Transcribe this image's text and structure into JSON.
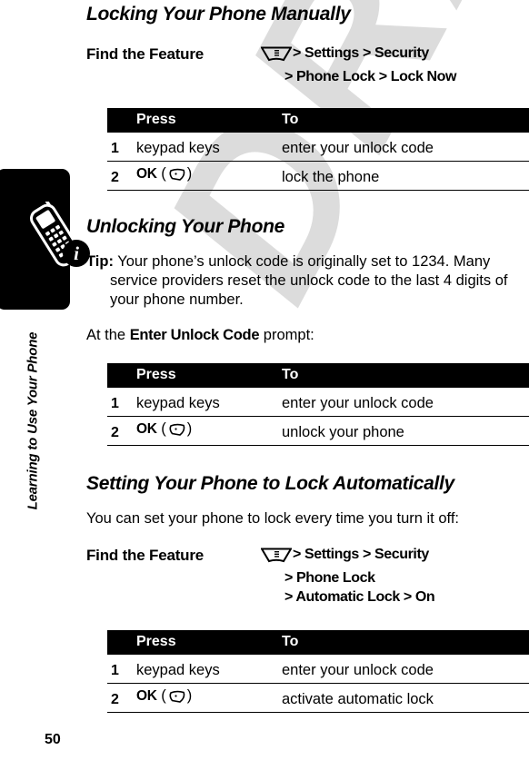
{
  "page": {
    "number": "50",
    "side_tab_title": "Learning to Use Your Phone",
    "watermark": "DRAFT",
    "info_badge_glyph": "i"
  },
  "sections": [
    {
      "heading": "Locking Your Phone Manually",
      "find_the_feature": {
        "label": "Find the Feature",
        "menu_icon": "menu-key-icon",
        "path_lines": [
          "> Settings > Security",
          "> Phone Lock > Lock Now"
        ]
      },
      "table": {
        "headers": [
          "",
          "Press",
          "To"
        ],
        "rows": [
          {
            "num": "1",
            "press": "keypad keys",
            "press_icon": "",
            "to": "enter your unlock code"
          },
          {
            "num": "2",
            "press": "OK",
            "press_icon": "softkey-icon",
            "to": "lock the phone"
          }
        ]
      }
    },
    {
      "heading": "Unlocking Your Phone",
      "tip_label": "Tip:",
      "tip_text": " Your phone’s unlock code is originally set to 1234. Many service providers reset the unlock code to the last 4 digits of your phone number.",
      "prompt_intro_before": "At the ",
      "prompt_name": "Enter Unlock Code",
      "prompt_intro_after": " prompt:",
      "table": {
        "headers": [
          "",
          "Press",
          "To"
        ],
        "rows": [
          {
            "num": "1",
            "press": "keypad keys",
            "press_icon": "",
            "to": "enter your unlock code"
          },
          {
            "num": "2",
            "press": "OK",
            "press_icon": "softkey-icon",
            "to": "unlock your phone"
          }
        ]
      }
    },
    {
      "heading": "Setting Your Phone to Lock Automatically",
      "intro": "You can set your phone to lock every time you turn it off:",
      "find_the_feature": {
        "label": "Find the Feature",
        "menu_icon": "menu-key-icon",
        "path_lines": [
          "> Settings > Security",
          "> Phone Lock",
          "> Automatic Lock > On"
        ]
      },
      "table": {
        "headers": [
          "",
          "Press",
          "To"
        ],
        "rows": [
          {
            "num": "1",
            "press": "keypad keys",
            "press_icon": "",
            "to": "enter your unlock code"
          },
          {
            "num": "2",
            "press": "OK",
            "press_icon": "softkey-icon",
            "to": "activate automatic lock"
          }
        ]
      }
    }
  ],
  "colors": {
    "text": "#000000",
    "header_bar": "#000000",
    "header_text": "#ffffff",
    "watermark": "#dcdcdc",
    "page_background": "#ffffff"
  }
}
